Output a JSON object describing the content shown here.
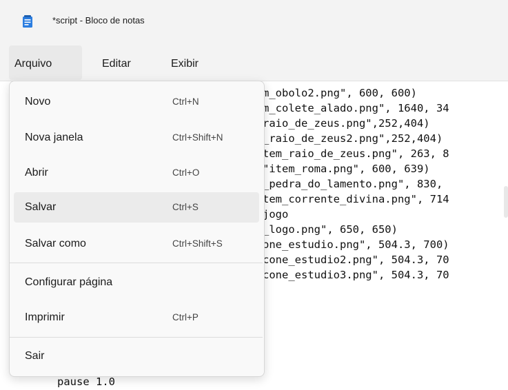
{
  "window": {
    "title": "*script - Bloco de notas",
    "icon": "notepad-icon"
  },
  "menubar": [
    {
      "label": "Arquivo",
      "active": true
    },
    {
      "label": "Editar"
    },
    {
      "label": "Exibir"
    }
  ],
  "file_menu": [
    {
      "label": "Novo",
      "shortcut": "Ctrl+N"
    },
    {
      "label": "Nova janela",
      "shortcut": "Ctrl+Shift+N"
    },
    {
      "label": "Abrir",
      "shortcut": "Ctrl+O"
    },
    {
      "label": "Salvar",
      "shortcut": "Ctrl+S",
      "hovered": true
    },
    {
      "label": "Salvar como",
      "shortcut": "Ctrl+Shift+S"
    },
    {
      "label": "Configurar página",
      "shortcut": ""
    },
    {
      "label": "Imprimir",
      "shortcut": "Ctrl+P"
    },
    {
      "label": "Sair",
      "shortcut": ""
    }
  ],
  "editor": {
    "visible_lines": [
      "m_obolo2.png\", 600, 600)",
      "m_colete_alado.png\", 1640, 34",
      "raio_de_zeus.png\",252,404)",
      "_raio_de_zeus2.png\",252,404)",
      "tem_raio_de_zeus.png\", 263, 8",
      "\"item_roma.png\", 600, 639)",
      "_pedra_do_lamento.png\", 830,",
      "tem_corrente_divina.png\", 714",
      "jogo",
      "_logo.png\", 650, 650)",
      "one_estudio.png\", 504.3, 700)",
      "cone_estudio2.png\", 504.3, 70",
      "cone_estudio3.png\", 504.3, 70"
    ],
    "bottom_line": "pause 1.0"
  },
  "colors": {
    "accent_icon": "#2b7de0",
    "menu_bg": "#f9f9f9",
    "hover": "#ebebeb"
  }
}
